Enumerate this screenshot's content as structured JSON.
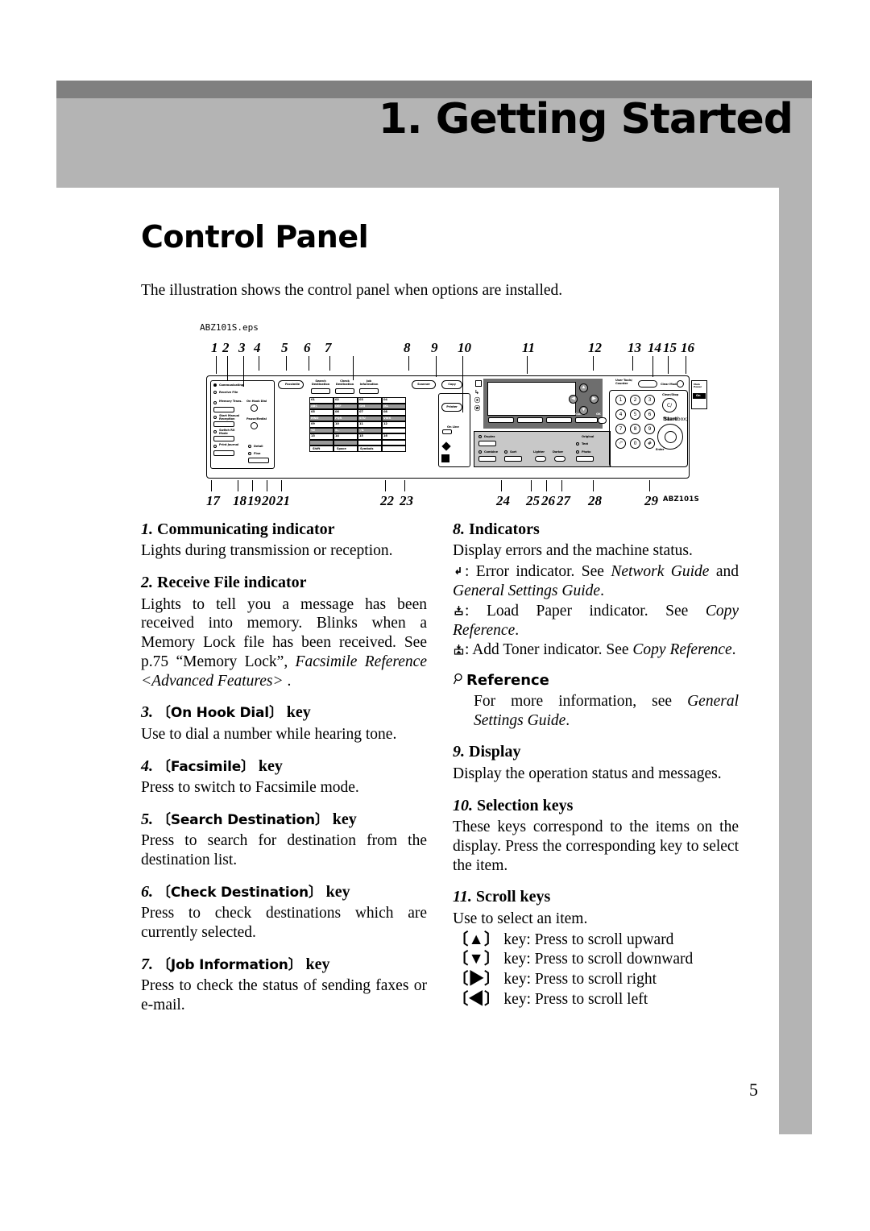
{
  "chapter": {
    "banner_title": "1. Getting Started"
  },
  "section": {
    "heading": "Control Panel",
    "intro": "The illustration shows the control panel when options are installed."
  },
  "figure": {
    "eps_label": "ABZ101S.eps",
    "code_label": "ABZ101S",
    "callouts_top": [
      "1",
      "2",
      "3",
      "4",
      "5",
      "6",
      "7",
      "8",
      "9",
      "10",
      "11",
      "12",
      "13",
      "14",
      "15",
      "16"
    ],
    "callouts_bottom": [
      "17",
      "18",
      "19",
      "20",
      "21",
      "22",
      "23",
      "24",
      "25",
      "26",
      "27",
      "28",
      "29"
    ],
    "panel_labels": {
      "communicating": "Communicating",
      "receive_file": "Receive File",
      "memory_trans": "Memory Trans.",
      "start_manual": "Start Manual Reception",
      "switch_rx": "Switch RX Mode",
      "print_journal": "Print Journal",
      "on_hook_dial": "On Hook Dial",
      "pause_redial": "Pause/Redial",
      "detail": "Detail",
      "fine": "Fine",
      "search_destination": "Search Destination",
      "check_destination": "Check Destination",
      "job_information": "Job Information",
      "scanner": "Scanner",
      "copy": "Copy",
      "printer": "Printer",
      "on_line": "On Line",
      "user_tools": "User Tools/ Counter",
      "clear_modes": "Clear Modes",
      "clear_stop": "Clear/Stop",
      "start": "Start",
      "cancel": "Cancel",
      "ok": "OK",
      "enter": "Enter",
      "duplex": "Duplex",
      "combine": "Combine",
      "sort": "Sort",
      "lighter": "Lighter",
      "darker": "Darker",
      "original": "Original",
      "text": "Text",
      "photo": "Photo",
      "main_power": "Main Power",
      "on_switch": "On",
      "shift": "Shift",
      "space": "Space",
      "symbols": "Symbols",
      "quick_dial_rows": [
        [
          "01",
          "02",
          "03",
          "04"
        ],
        [
          "ABC",
          "DEF",
          "GHI",
          "JKL"
        ],
        [
          "05",
          "06",
          "07",
          "08"
        ],
        [
          "MNO",
          "PQR",
          "STU",
          "VWX"
        ],
        [
          "09",
          "10",
          "11",
          "12"
        ],
        [
          "YZ",
          "&.,",
          "-/&",
          "  "
        ],
        [
          "13",
          "14",
          "15",
          "16"
        ]
      ]
    }
  },
  "items_left": [
    {
      "num": "1.",
      "title": "Communicating indicator",
      "bracket": false,
      "body": "Lights during transmission or reception."
    },
    {
      "num": "2.",
      "title": "Receive File indicator",
      "bracket": false,
      "body_pre": "Lights to tell you a message has been received into memory. Blinks when a Memory Lock file has been received. See p.75 “Memory Lock”, ",
      "body_it": "Facsimile Reference <Advanced Features>",
      "body_post": " ."
    },
    {
      "num": "3.",
      "key": "On Hook Dial",
      "suffix": "key",
      "bracket": true,
      "body": "Use to dial a number while hearing tone."
    },
    {
      "num": "4.",
      "key": "Facsimile",
      "suffix": "key",
      "bracket": true,
      "body": "Press to switch to Facsimile mode."
    },
    {
      "num": "5.",
      "key": "Search Destination",
      "suffix": "key",
      "bracket": true,
      "body": "Press to search for destination from the destination list."
    },
    {
      "num": "6.",
      "key": "Check Destination",
      "suffix": "key",
      "bracket": true,
      "body": "Press to check destinations which are currently selected."
    },
    {
      "num": "7.",
      "key": "Job Information",
      "suffix": "key",
      "bracket": true,
      "body": "Press to check the status of sending faxes or e-mail."
    }
  ],
  "item8": {
    "num": "8.",
    "title": "Indicators",
    "body": "Display errors and the machine status.",
    "indicators": [
      {
        "icon": "error-indicator-icon",
        "pre": ": Error indicator. See ",
        "it": "Network Guide",
        "mid": " and ",
        "it2": "General Settings Guide",
        "post": "."
      },
      {
        "icon": "load-paper-indicator-icon",
        "pre": ": Load Paper indicator. See ",
        "it": "Copy Reference",
        "post": "."
      },
      {
        "icon": "add-toner-indicator-icon",
        "pre": ": Add Toner indicator. See ",
        "it": "Copy Reference",
        "post": "."
      }
    ]
  },
  "reference": {
    "title": "Reference",
    "pre": "For more information, see ",
    "it": "General Settings Guide",
    "post": "."
  },
  "items_right": [
    {
      "num": "9.",
      "title": "Display",
      "body": "Display the operation status and messages."
    },
    {
      "num": "10.",
      "title": "Selection keys",
      "body": "These keys correspond to the items on the display. Press the corresponding key to select the item."
    },
    {
      "num": "11.",
      "title": "Scroll keys",
      "body": "Use to select an item.",
      "lines": [
        {
          "arrow": "▲",
          "text": "key: Press to scroll upward"
        },
        {
          "arrow": "▼",
          "text": "key: Press to scroll downward"
        },
        {
          "arrow": "▶",
          "text": "key: Press to scroll right"
        },
        {
          "arrow": "◀",
          "text": "key: Press to scroll left"
        }
      ]
    }
  ],
  "page_number": "5",
  "colors": {
    "banner_top": "#808080",
    "banner_body": "#b4b4b4",
    "text": "#000000"
  }
}
